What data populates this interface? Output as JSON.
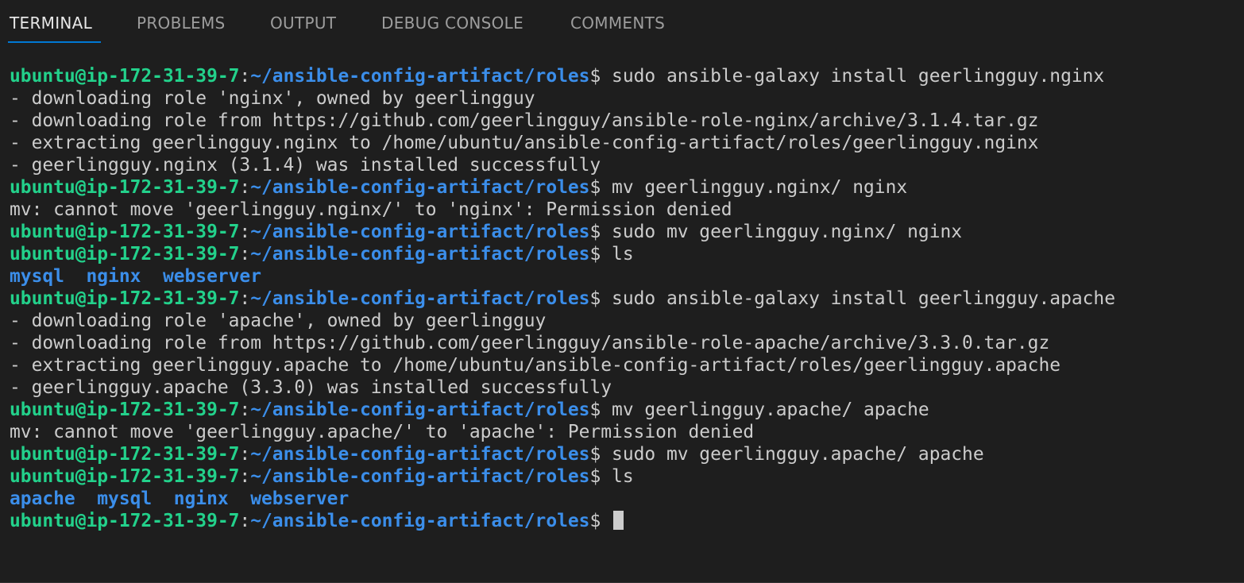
{
  "tabs": [
    {
      "label": "TERMINAL",
      "active": true
    },
    {
      "label": "PROBLEMS",
      "active": false
    },
    {
      "label": "OUTPUT",
      "active": false
    },
    {
      "label": "DEBUG CONSOLE",
      "active": false
    },
    {
      "label": "COMMENTS",
      "active": false
    }
  ],
  "prompt": {
    "user_host": "ubuntu@ip-172-31-39-7",
    "separator": ":",
    "path": "~/ansible-config-artifact/roles",
    "symbol": "$"
  },
  "lines": [
    {
      "kind": "command",
      "text": " sudo ansible-galaxy install geerlingguy.nginx"
    },
    {
      "kind": "output",
      "text": "- downloading role 'nginx', owned by geerlingguy"
    },
    {
      "kind": "output",
      "text": "- downloading role from https://github.com/geerlingguy/ansible-role-nginx/archive/3.1.4.tar.gz"
    },
    {
      "kind": "output",
      "text": "- extracting geerlingguy.nginx to /home/ubuntu/ansible-config-artifact/roles/geerlingguy.nginx"
    },
    {
      "kind": "output",
      "text": "- geerlingguy.nginx (3.1.4) was installed successfully"
    },
    {
      "kind": "command",
      "text": " mv geerlingguy.nginx/ nginx"
    },
    {
      "kind": "output",
      "text": "mv: cannot move 'geerlingguy.nginx/' to 'nginx': Permission denied"
    },
    {
      "kind": "command",
      "text": " sudo mv geerlingguy.nginx/ nginx"
    },
    {
      "kind": "command",
      "text": " ls"
    },
    {
      "kind": "listing",
      "text": "mysql  nginx  webserver"
    },
    {
      "kind": "command",
      "text": " sudo ansible-galaxy install geerlingguy.apache"
    },
    {
      "kind": "output",
      "text": "- downloading role 'apache', owned by geerlingguy"
    },
    {
      "kind": "output",
      "text": "- downloading role from https://github.com/geerlingguy/ansible-role-apache/archive/3.3.0.tar.gz"
    },
    {
      "kind": "output",
      "text": "- extracting geerlingguy.apache to /home/ubuntu/ansible-config-artifact/roles/geerlingguy.apache"
    },
    {
      "kind": "output",
      "text": "- geerlingguy.apache (3.3.0) was installed successfully"
    },
    {
      "kind": "command",
      "text": " mv geerlingguy.apache/ apache"
    },
    {
      "kind": "output",
      "text": "mv: cannot move 'geerlingguy.apache/' to 'apache': Permission denied"
    },
    {
      "kind": "command",
      "text": " sudo mv geerlingguy.apache/ apache"
    },
    {
      "kind": "command",
      "text": " ls"
    },
    {
      "kind": "listing",
      "text": "apache  mysql  nginx  webserver"
    },
    {
      "kind": "command",
      "text": " "
    }
  ],
  "colors": {
    "background": "#1e1e1e",
    "prompt_user": "#23d18b",
    "prompt_path": "#3b8eea",
    "text": "#cccccc",
    "tab_active_underline": "#0078d4"
  }
}
